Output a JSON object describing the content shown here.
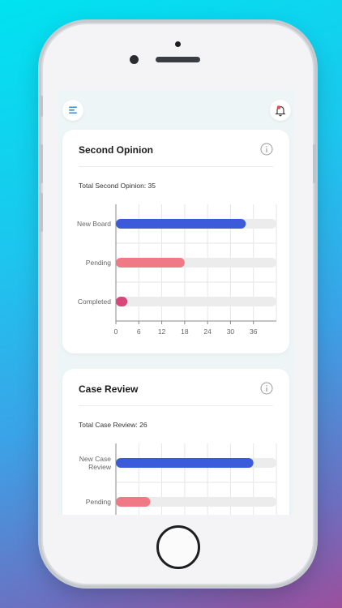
{
  "header": {
    "menu_icon": "hamburger-menu-icon",
    "notification_icon": "notification-bell-icon",
    "notification_color": "#e0505a"
  },
  "colors": {
    "bar_blue": "#3b5bdb",
    "bar_pink": "#ef7a86",
    "bar_magenta": "#d9467a",
    "track": "#ececec"
  },
  "cards": [
    {
      "title": "Second Opinion",
      "info_icon": "info-icon",
      "total_text": "Total Second Opinion: 35",
      "chart_data": {
        "type": "bar",
        "orientation": "horizontal",
        "categories": [
          "New Board",
          "Pending",
          "Completed"
        ],
        "values": [
          34,
          18,
          3
        ],
        "bar_colors": [
          "#3b5bdb",
          "#ef7a86",
          "#d9467a"
        ],
        "xticks": [
          "0",
          "6",
          "12",
          "18",
          "24",
          "30",
          "36"
        ],
        "xlim": [
          0,
          42
        ],
        "grid": true
      }
    },
    {
      "title": "Case Review",
      "info_icon": "info-icon",
      "total_text": "Total Case Review: 26",
      "chart_data": {
        "type": "bar",
        "orientation": "horizontal",
        "categories": [
          "New Case Review",
          "Pending"
        ],
        "values": [
          36,
          9
        ],
        "bar_colors": [
          "#3b5bdb",
          "#ef7a86"
        ],
        "xticks": [],
        "xlim": [
          0,
          42
        ],
        "grid": true
      }
    }
  ]
}
